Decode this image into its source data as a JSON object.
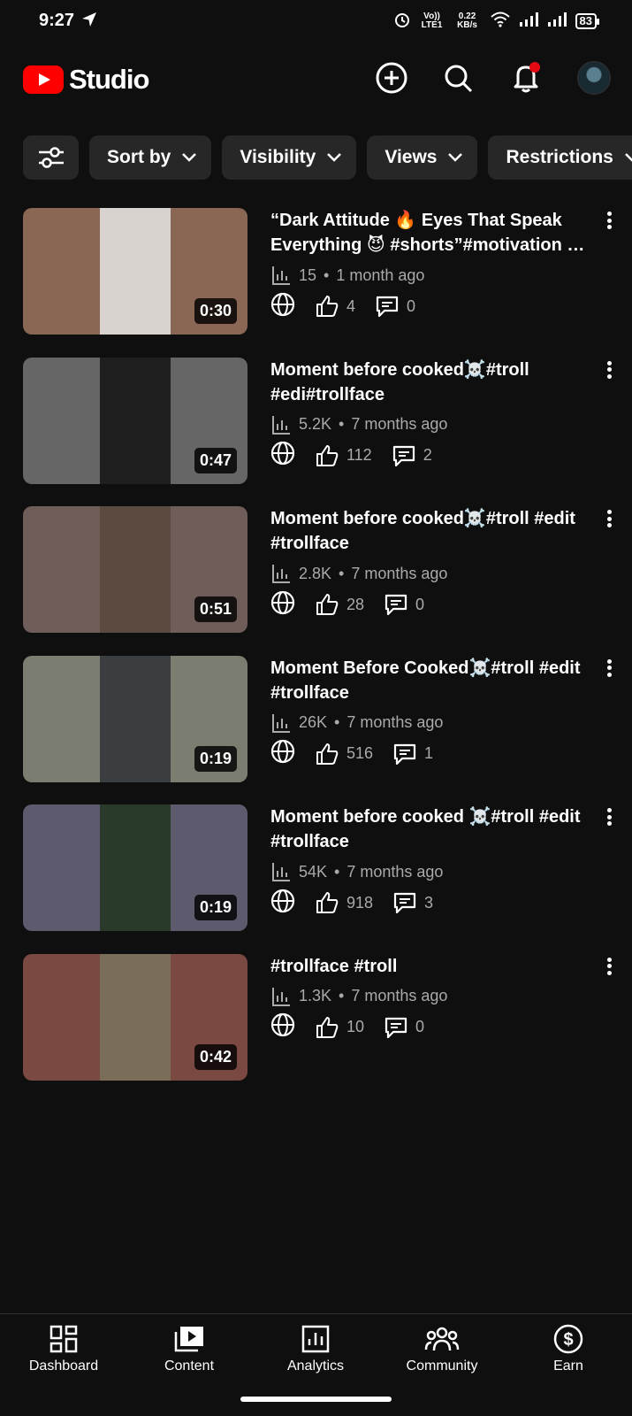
{
  "status_bar": {
    "time": "9:27",
    "network_label_1": "Vo)) LTE1",
    "network_speed": "0.22 KB/s",
    "battery": "83"
  },
  "header": {
    "logo_text": "Studio"
  },
  "filters": {
    "items": [
      {
        "label": "Sort by"
      },
      {
        "label": "Visibility"
      },
      {
        "label": "Views"
      },
      {
        "label": "Restrictions"
      }
    ]
  },
  "videos": [
    {
      "title": "“Dark Attitude 🔥 Eyes That Speak Everything 😈 #shorts”#motivation …",
      "views": "15",
      "age": "1 month ago",
      "likes": "4",
      "comments": "0",
      "duration": "0:30",
      "bg": "#8a6655",
      "inner": "#d8d3cf"
    },
    {
      "title": "Moment before cooked☠️#troll #edi#trollface",
      "views": "5.2K",
      "age": "7 months ago",
      "likes": "112",
      "comments": "2",
      "duration": "0:47",
      "bg": "#666666",
      "inner": "#1f1f1f"
    },
    {
      "title": "Moment before cooked☠️#troll #edit #trollface",
      "views": "2.8K",
      "age": "7 months ago",
      "likes": "28",
      "comments": "0",
      "duration": "0:51",
      "bg": "#6f5d5a",
      "inner": "#5b4a40"
    },
    {
      "title": "Moment Before Cooked☠️#troll #edit #trollface",
      "views": "26K",
      "age": "7 months ago",
      "likes": "516",
      "comments": "1",
      "duration": "0:19",
      "bg": "#7b7d70",
      "inner": "#3a3e40"
    },
    {
      "title": "Moment before cooked ☠️#troll #edit #trollface",
      "views": "54K",
      "age": "7 months ago",
      "likes": "918",
      "comments": "3",
      "duration": "0:19",
      "bg": "#5d5a6d",
      "inner": "#2a3a2a"
    },
    {
      "title": "#trollface #troll",
      "views": "1.3K",
      "age": "7 months ago",
      "likes": "10",
      "comments": "0",
      "duration": "0:42",
      "bg": "#7a4a42",
      "inner": "#7a6e58"
    }
  ],
  "bottom_nav": [
    {
      "label": "Dashboard"
    },
    {
      "label": "Content"
    },
    {
      "label": "Analytics"
    },
    {
      "label": "Community"
    },
    {
      "label": "Earn"
    }
  ]
}
